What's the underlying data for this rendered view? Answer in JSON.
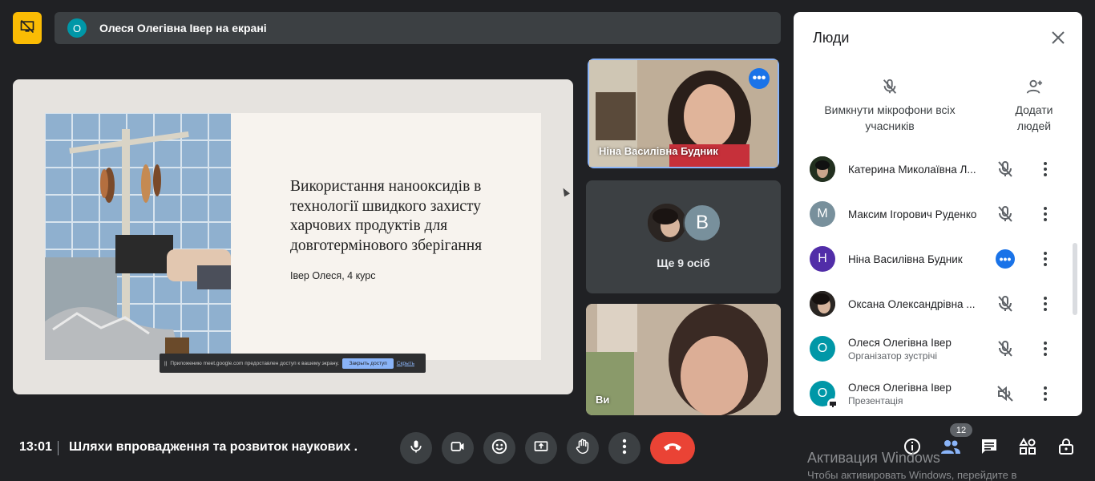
{
  "header": {
    "presenter_initial": "О",
    "presenting_text": "Олеся Олегівна Івер на екрані"
  },
  "slide": {
    "title": "Використання нанооксидів в технології швидкого захисту харчових продуктів для довготермінового зберігання",
    "subtitle": "Івер Олеся, 4 курс",
    "share_notice": {
      "text": "Приложению meet.google.com предоставлен доступ к вашему экрану.",
      "stop_label": "Закрыть доступ",
      "hide_label": "Скрыть"
    }
  },
  "tiles": {
    "tile1_name": "Ніна Василівна Будник",
    "more_label": "Ще 9 осіб",
    "more_avatar_letter": "В",
    "self_label": "Ви"
  },
  "people_panel": {
    "title": "Люди",
    "mute_all_label": "Вимкнути мікрофони всіх учасників",
    "add_people_label": "Додати людей",
    "participants": [
      {
        "name": "Катерина Миколаївна Л...",
        "sub": "",
        "initial": "",
        "color": "#2b3a2c",
        "state": "muted"
      },
      {
        "name": "Максим Ігорович Руденко",
        "sub": "",
        "initial": "М",
        "color": "#78909c",
        "state": "muted"
      },
      {
        "name": "Ніна Василівна Будник",
        "sub": "",
        "initial": "Н",
        "color": "#512da8",
        "state": "more"
      },
      {
        "name": "Оксана Олександрівна ...",
        "sub": "",
        "initial": "",
        "color": "#2a2623",
        "state": "muted"
      },
      {
        "name": "Олеся Олегівна Івер",
        "sub": "Організатор зустрічі",
        "initial": "О",
        "color": "#0097a7",
        "state": "muted"
      },
      {
        "name": "Олеся Олегівна Івер",
        "sub": "Презентація",
        "initial": "О",
        "color": "#0097a7",
        "state": "sound-off"
      }
    ]
  },
  "bottom_bar": {
    "time": "13:01",
    "meeting_title": "Шляхи впровадження та розвиток наукових ...",
    "people_count": "12"
  },
  "watermark": {
    "line1": "Активация Windows",
    "line2": "Чтобы активировать Windows, перейдите в"
  },
  "colors": {
    "accent": "#1a73e8",
    "hangup": "#ea4335",
    "presenter_badge": "#fbbc04",
    "bar": "#3c4043"
  }
}
